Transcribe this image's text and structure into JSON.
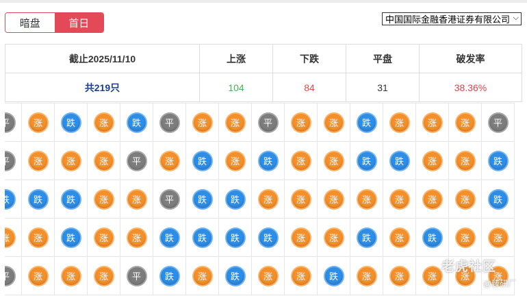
{
  "tabs": [
    {
      "label": "暗盘",
      "active": false
    },
    {
      "label": "首日",
      "active": true
    }
  ],
  "broker_select": {
    "selected": "中国国际金融香港证券有限公司",
    "icon": "chevron-down-icon"
  },
  "summary": {
    "headers": [
      "截止2025/11/10",
      "上涨",
      "下跌",
      "平盘",
      "破发率"
    ],
    "count_label": "共219只",
    "up": "104",
    "down": "84",
    "flat": "31",
    "break_rate": "38.36%"
  },
  "ball_labels": {
    "up": "涨",
    "down": "跌",
    "flat": "平"
  },
  "grid": [
    [
      "flat",
      "up",
      "down",
      "up",
      "down",
      "flat",
      "up",
      "up",
      "flat",
      "up",
      "up",
      "down",
      "up",
      "up",
      "up",
      "flat"
    ],
    [
      "flat",
      "up",
      "up",
      "up",
      "flat",
      "up",
      "down",
      "up",
      "down",
      "up",
      "up",
      "down",
      "down",
      "up",
      "up",
      "down"
    ],
    [
      "down",
      "down",
      "down",
      "up",
      "up",
      "flat",
      "down",
      "down",
      "up",
      "up",
      "up",
      "up",
      "up",
      "up",
      "up",
      "down"
    ],
    [
      "up",
      "up",
      "down",
      "up",
      "up",
      "down",
      "down",
      "down",
      "down",
      "up",
      "up",
      "down",
      "up",
      "down",
      "up",
      "up"
    ],
    [
      "flat",
      "up",
      "up",
      "up",
      "flat",
      "down",
      "up",
      "down",
      "up",
      "up",
      "down",
      "up",
      "up",
      "up",
      "up",
      "up"
    ]
  ],
  "colors": {
    "up": "#f58f2a",
    "down": "#2f8de4",
    "flat": "#7d7d7d",
    "accent": "#e34957"
  },
  "watermark": {
    "main": "老虎社区",
    "sub": "@臻研厂"
  }
}
